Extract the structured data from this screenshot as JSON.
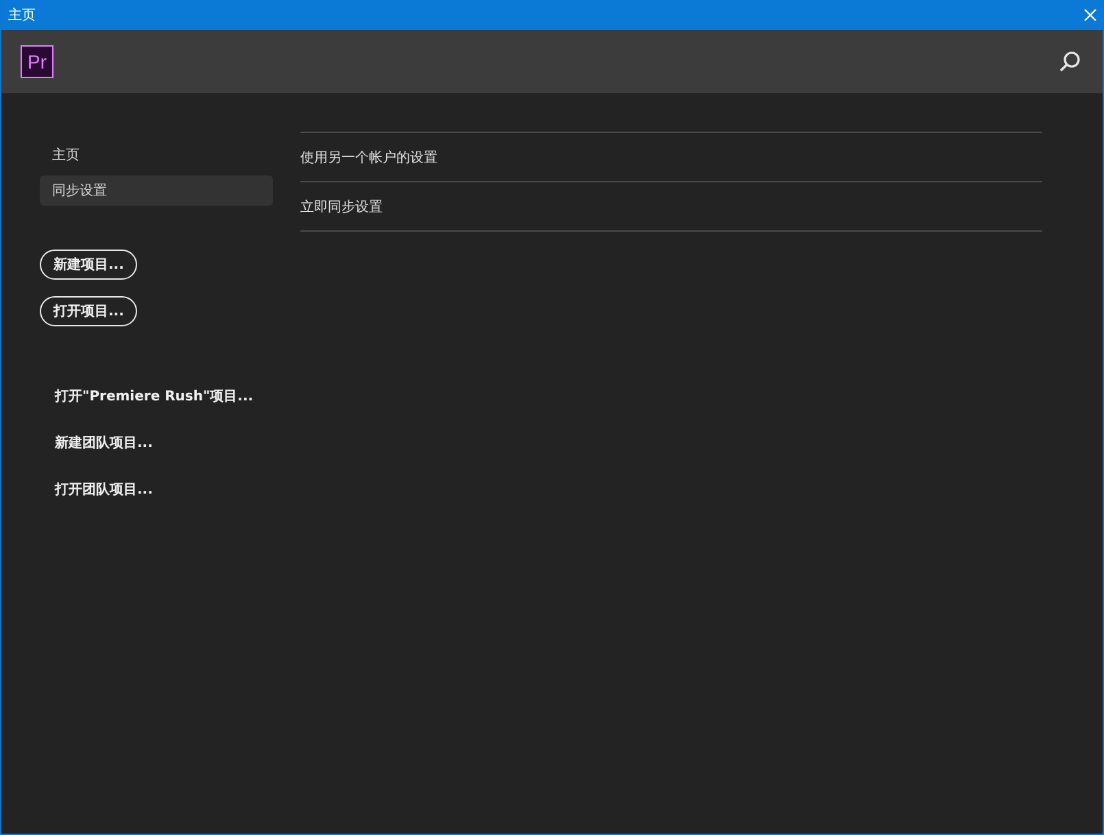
{
  "window": {
    "title": "主页"
  },
  "header": {
    "logo": "Pr"
  },
  "sidebar": {
    "items": [
      {
        "label": "主页",
        "selected": false
      },
      {
        "label": "同步设置",
        "selected": true
      }
    ],
    "buttons": [
      "新建项目...",
      "打开项目..."
    ],
    "links": [
      "打开\"Premiere Rush\"项目...",
      "新建团队项目...",
      "打开团队项目..."
    ]
  },
  "content": {
    "items": [
      "使用另一个帐户的设置",
      "立即同步设置"
    ]
  }
}
